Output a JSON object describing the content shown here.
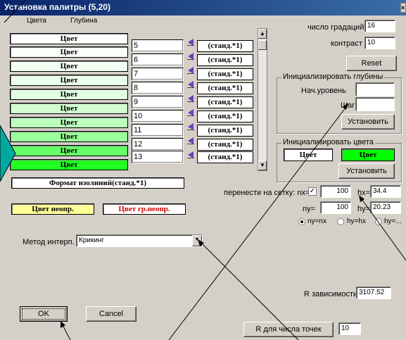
{
  "window": {
    "title": "Установка палитры (5,20)",
    "close_glyph": "×"
  },
  "tabs": [
    {
      "label": "Цвета"
    },
    {
      "label": "Глубина"
    }
  ],
  "palette": {
    "color_buttons": [
      {
        "label": "Цвет",
        "color": "#ffffff"
      },
      {
        "label": "Цвет",
        "color": "#fafffa"
      },
      {
        "label": "Цвет",
        "color": "#f4fff4"
      },
      {
        "label": "Цвет",
        "color": "#ecffec"
      },
      {
        "label": "Цвет",
        "color": "#e2ffe2"
      },
      {
        "label": "Цвет",
        "color": "#d2ffd2"
      },
      {
        "label": "Цвет",
        "color": "#bcffbc"
      },
      {
        "label": "Цвет",
        "color": "#9bff9b"
      },
      {
        "label": "Цвет",
        "color": "#66ff66"
      },
      {
        "label": "Цвет",
        "color": "#22ff22"
      }
    ],
    "values": [
      "5",
      "6",
      "7",
      "8",
      "9",
      "10",
      "11",
      "12",
      "13"
    ],
    "std_buttons": [
      "(станд.*1)",
      "(станд.*1)",
      "(станд.*1)",
      "(станд.*1)",
      "(станд.*1)",
      "(станд.*1)",
      "(станд.*1)",
      "(станд.*1)",
      "(станд.*1)"
    ],
    "isoline_format_label": "Формат изолиний(станд.*1)",
    "undef_color_label": "Цвет неопр.",
    "undef_color_bg": "#ffff99",
    "border_undef_label": "Цвет гр.неопр.",
    "border_undef_text_color": "#cc0000"
  },
  "right": {
    "gradations_label": "число градаций",
    "gradations_value": "16",
    "contrast_label": "контраст",
    "contrast_value": "10",
    "reset_label": "Reset",
    "init_depth": {
      "title": "Инициализировать глубины",
      "start_label": "Нач.уровень",
      "start_value": "",
      "step_label": "Шаг",
      "step_value": "",
      "set_label": "Установить"
    },
    "init_color": {
      "title": "Инициализировать цвета",
      "color1_label": "Цвет",
      "color1_bg": "#ffffff",
      "color2_label": "Цвет",
      "color2_bg": "#00ff00",
      "set_label": "Установить"
    }
  },
  "grid": {
    "transfer_label": "перенести на сетку: nx=",
    "checked": true,
    "check_glyph": "✓",
    "nx_value": "100",
    "hx_label": "hx=",
    "hx_value": "34.4",
    "ny_label": "ny=",
    "ny_value": "100",
    "hy_label": "hy=",
    "hy_value": "20.23",
    "radio_options": [
      {
        "label": "ny=nx",
        "selected": true
      },
      {
        "label": "hy=hx",
        "selected": false
      },
      {
        "label": "hy=...",
        "selected": false
      }
    ]
  },
  "interp": {
    "label": "Метод интерп.",
    "value": "Крикинг",
    "dropdown_glyph": "▼"
  },
  "dependency": {
    "label": "R зависимости",
    "value": "3107.52"
  },
  "points": {
    "button_label": "R для числа точек",
    "value": "10"
  },
  "footer": {
    "ok_label": "OK",
    "cancel_label": "Cancel"
  },
  "colors": {
    "title_gradient_start": "#0a246a",
    "title_gradient_end": "#3a6ea5",
    "dialog_bg": "#d4d0c8",
    "arrow_color": "#6a3fbf",
    "pointer_teal": "#00a8a0"
  }
}
